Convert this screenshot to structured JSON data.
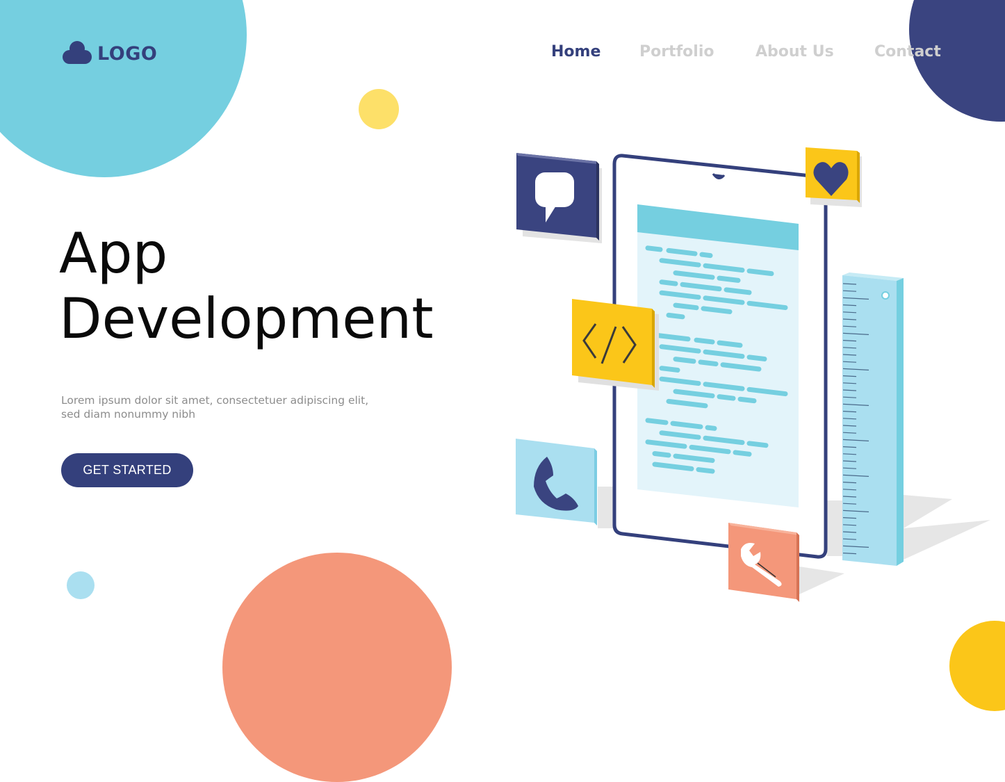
{
  "brand": {
    "logo_text": "LOGO",
    "logo_icon": "cloud-icon"
  },
  "nav": {
    "items": [
      {
        "label": "Home",
        "active": true
      },
      {
        "label": "Portfolio",
        "active": false
      },
      {
        "label": "About Us",
        "active": false
      },
      {
        "label": "Contact",
        "active": false
      }
    ]
  },
  "hero": {
    "title_line1": "App",
    "title_line2": "Development",
    "subtitle": "Lorem ipsum dolor sit amet, consectetuer adipiscing elit, sed diam nonummy nibh",
    "cta_label": "GET STARTED"
  },
  "illustration": {
    "subject": "smartphone-with-code",
    "tiles": [
      {
        "icon": "chat-bubble-icon",
        "color": "#3a4480"
      },
      {
        "icon": "heart-icon",
        "color": "#fbc619"
      },
      {
        "icon": "code-icon",
        "color": "#fbc619"
      },
      {
        "icon": "phone-icon",
        "color": "#aadff0"
      },
      {
        "icon": "wrench-icon",
        "color": "#f4977a"
      }
    ],
    "extra": "ruler-icon"
  },
  "colors": {
    "primary": "#34407c",
    "accent_teal": "#75cfe0",
    "accent_yellow": "#fbc619",
    "accent_salmon": "#f4977a",
    "nav_inactive": "#cfcfcf"
  }
}
